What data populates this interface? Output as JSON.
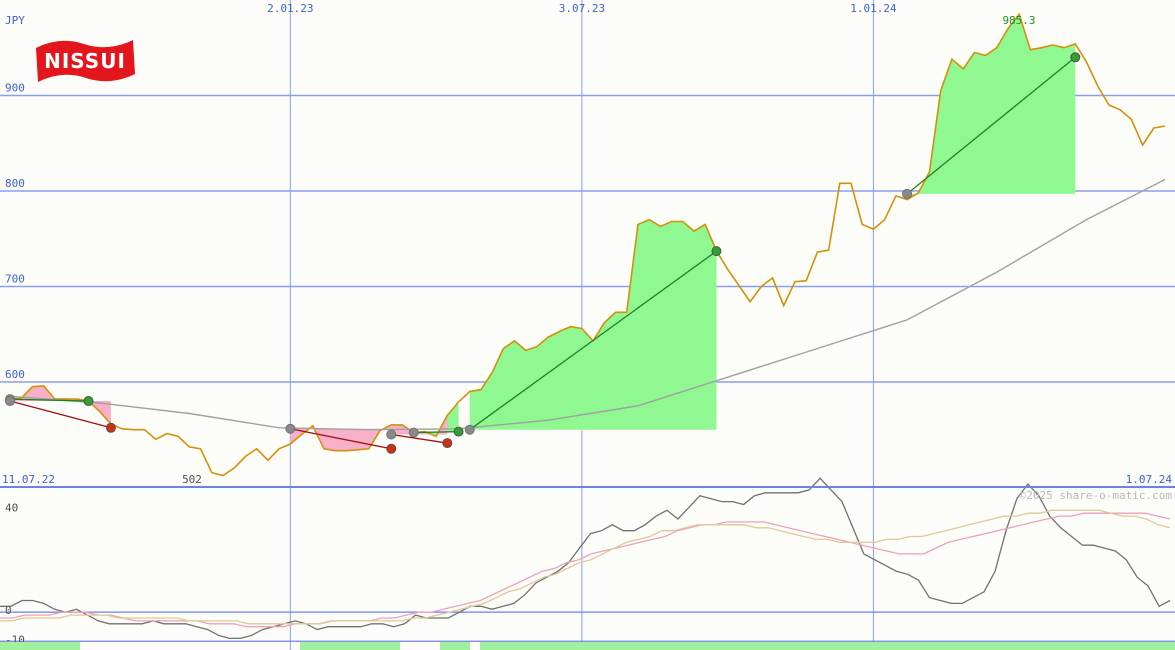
{
  "logo": {
    "text": "NISSUI",
    "color": "#e2161c"
  },
  "copyright": "©2025 share-o-matic.com",
  "chart_data": [
    {
      "type": "line",
      "currency_label": "JPY",
      "y_tick_labels": [
        "600",
        "700",
        "800",
        "900"
      ],
      "y_ticks": [
        600,
        700,
        800,
        900
      ],
      "ylim": [
        490,
        1000
      ],
      "x_tick_labels_top": [
        "2.01.23",
        "3.07.23",
        "1.01.24"
      ],
      "x_ticks": [
        "2023-01-02",
        "2023-07-03",
        "2024-01-01"
      ],
      "x_start_label": "11.07.22",
      "x_end_label": "1.07.24",
      "xlim": [
        "2022-07-11",
        "2024-07-01"
      ],
      "min_label": "502",
      "max_label": "985.3",
      "grid": true,
      "colors": {
        "price": "#d4900a",
        "average": "#a0a0a0",
        "gain": "#90f890",
        "loss": "#f8b0c8",
        "gain_line": "#208020",
        "loss_line": "#a01010",
        "grid": "#8a9ef0"
      },
      "series": [
        {
          "key": "price",
          "x": [
            "2022-07-11",
            "2022-07-18",
            "2022-07-25",
            "2022-08-01",
            "2022-08-08",
            "2022-08-15",
            "2022-08-22",
            "2022-08-29",
            "2022-09-05",
            "2022-09-12",
            "2022-09-19",
            "2022-09-26",
            "2022-10-03",
            "2022-10-10",
            "2022-10-17",
            "2022-10-24",
            "2022-10-31",
            "2022-11-07",
            "2022-11-14",
            "2022-11-21",
            "2022-11-28",
            "2022-12-05",
            "2022-12-12",
            "2022-12-19",
            "2022-12-26",
            "2023-01-02",
            "2023-01-09",
            "2023-01-16",
            "2023-01-23",
            "2023-01-30",
            "2023-02-06",
            "2023-02-13",
            "2023-02-20",
            "2023-02-27",
            "2023-03-06",
            "2023-03-13",
            "2023-03-20",
            "2023-03-27",
            "2023-04-03",
            "2023-04-10",
            "2023-04-17",
            "2023-04-24",
            "2023-05-01",
            "2023-05-08",
            "2023-05-15",
            "2023-05-22",
            "2023-05-29",
            "2023-06-05",
            "2023-06-12",
            "2023-06-19",
            "2023-06-26",
            "2023-07-03",
            "2023-07-10",
            "2023-07-17",
            "2023-07-24",
            "2023-07-31",
            "2023-08-07",
            "2023-08-14",
            "2023-08-21",
            "2023-08-28",
            "2023-09-04",
            "2023-09-11",
            "2023-09-18",
            "2023-09-25",
            "2023-10-02",
            "2023-10-09",
            "2023-10-16",
            "2023-10-23",
            "2023-10-30",
            "2023-11-06",
            "2023-11-13",
            "2023-11-20",
            "2023-11-27",
            "2023-12-04",
            "2023-12-11",
            "2023-12-18",
            "2023-12-25",
            "2024-01-01",
            "2024-01-08",
            "2024-01-15",
            "2024-01-22",
            "2024-01-29",
            "2024-02-05",
            "2024-02-12",
            "2024-02-19",
            "2024-02-26",
            "2024-03-04",
            "2024-03-11",
            "2024-03-18",
            "2024-03-25",
            "2024-04-01",
            "2024-04-08",
            "2024-04-15",
            "2024-04-22",
            "2024-04-29",
            "2024-05-06",
            "2024-05-13",
            "2024-05-20",
            "2024-05-27",
            "2024-06-03",
            "2024-06-10",
            "2024-06-17",
            "2024-06-24",
            "2024-07-01"
          ],
          "values": [
            582,
            583,
            595,
            596,
            582,
            582,
            582,
            580,
            569,
            556,
            551,
            550,
            550,
            540,
            546,
            543,
            532,
            530,
            505,
            502,
            510,
            522,
            530,
            518,
            530,
            535,
            545,
            554,
            530,
            528,
            528,
            529,
            530,
            549,
            555,
            555,
            547,
            548,
            543,
            565,
            579,
            590,
            592,
            610,
            635,
            643,
            633,
            637,
            647,
            653,
            658,
            656,
            643,
            662,
            673,
            673,
            765,
            770,
            763,
            768,
            768,
            758,
            765,
            737,
            718,
            701,
            684,
            700,
            709,
            680,
            705,
            706,
            736,
            738,
            808,
            808,
            765,
            760,
            770,
            795,
            791,
            798,
            820,
            905,
            938,
            928,
            945,
            942,
            950,
            970,
            985,
            948,
            950,
            953,
            950,
            954,
            935,
            910,
            890,
            885,
            875,
            848,
            866,
            868
          ]
        },
        {
          "key": "average",
          "x": [
            "2022-07-11",
            "2022-09-05",
            "2022-10-31",
            "2022-12-26",
            "2023-02-20",
            "2023-04-17",
            "2023-06-12",
            "2023-08-07",
            "2023-10-02",
            "2023-11-27",
            "2024-01-22",
            "2024-03-18",
            "2024-05-13",
            "2024-07-01"
          ],
          "values": [
            585,
            578,
            567,
            552,
            550,
            551,
            560,
            575,
            605,
            635,
            665,
            715,
            770,
            812
          ]
        }
      ],
      "gain_trades": [
        {
          "start": [
            "2022-07-11",
            582
          ],
          "end": [
            "2022-08-29",
            580
          ]
        },
        {
          "start": [
            "2023-03-20",
            547
          ],
          "end": [
            "2023-04-17",
            548
          ]
        },
        {
          "start": [
            "2023-04-24",
            550
          ],
          "end": [
            "2023-09-25",
            737
          ]
        },
        {
          "start": [
            "2024-01-22",
            797
          ],
          "end": [
            "2024-05-06",
            940
          ]
        }
      ],
      "loss_trades": [
        {
          "start": [
            "2022-07-11",
            580
          ],
          "end": [
            "2022-09-12",
            552
          ]
        },
        {
          "start": [
            "2023-01-02",
            551
          ],
          "end": [
            "2023-03-06",
            530
          ]
        },
        {
          "start": [
            "2023-03-06",
            545
          ],
          "end": [
            "2023-04-10",
            536
          ]
        }
      ]
    },
    {
      "type": "line",
      "y_tick_labels": [
        "40",
        "0",
        "-10"
      ],
      "y_ticks": [
        40,
        0,
        -10
      ],
      "ylim": [
        -13,
        43
      ],
      "colors": {
        "momentum": "#707070",
        "signal_fast": "#f0a0b8",
        "signal_slow": "#e0c898",
        "volume": "#a0f0a0"
      },
      "series": [
        {
          "key": "momentum",
          "values": [
            2,
            2,
            4,
            4,
            3,
            1,
            0,
            1,
            -1,
            -3,
            -4,
            -4,
            -4,
            -4,
            -3,
            -4,
            -4,
            -4,
            -5,
            -6,
            -8,
            -9,
            -9,
            -8,
            -6,
            -5,
            -4,
            -3,
            -4,
            -6,
            -5,
            -5,
            -5,
            -5,
            -4,
            -4,
            -5,
            -4,
            -1,
            -2,
            -2,
            -2,
            0,
            2,
            2,
            1,
            2,
            3,
            6,
            10,
            12,
            14,
            17,
            22,
            27,
            28,
            30,
            28,
            28,
            30,
            33,
            35,
            32,
            36,
            40,
            39,
            38,
            38,
            37,
            40,
            41,
            41,
            41,
            41,
            42,
            46,
            42,
            38,
            29,
            20,
            18,
            16,
            14,
            13,
            11,
            5,
            4,
            3,
            3,
            5,
            7,
            14,
            28,
            39,
            44,
            40,
            33,
            29,
            26,
            23,
            23,
            22,
            21,
            18,
            12,
            9,
            2,
            4
          ]
        },
        {
          "key": "signal_fast",
          "values": [
            -2,
            -2,
            -1,
            -1,
            -1,
            0,
            0,
            0,
            -1,
            -1,
            -2,
            -3,
            -3,
            -3,
            -3,
            -3,
            -3,
            -4,
            -4,
            -4,
            -5,
            -5,
            -5,
            -5,
            -4,
            -4,
            -4,
            -3,
            -3,
            -3,
            -3,
            -2,
            -2,
            -1,
            0,
            0,
            1,
            2,
            3,
            4,
            6,
            8,
            10,
            12,
            14,
            15,
            17,
            18,
            20,
            21,
            22,
            23,
            24,
            25,
            26,
            28,
            29,
            30,
            30,
            31,
            31,
            31,
            31,
            30,
            29,
            28,
            27,
            26,
            25,
            24,
            23,
            22,
            21,
            20,
            20,
            20,
            22,
            24,
            25,
            26,
            27,
            28,
            29,
            30,
            31,
            32,
            33,
            33,
            34,
            34,
            34,
            34,
            34,
            34,
            33,
            32
          ]
        },
        {
          "key": "signal_slow",
          "values": [
            -3,
            -3,
            -2,
            -2,
            -2,
            -2,
            -1,
            -1,
            -1,
            -1,
            -2,
            -2,
            -2,
            -2,
            -2,
            -2,
            -3,
            -3,
            -3,
            -3,
            -3,
            -4,
            -4,
            -4,
            -4,
            -4,
            -4,
            -4,
            -3,
            -3,
            -3,
            -3,
            -3,
            -3,
            -3,
            -2,
            -2,
            -1,
            0,
            1,
            2,
            3,
            5,
            7,
            8,
            10,
            12,
            13,
            15,
            17,
            18,
            20,
            22,
            24,
            25,
            26,
            28,
            28,
            29,
            30,
            30,
            30,
            30,
            30,
            29,
            29,
            28,
            27,
            26,
            25,
            25,
            24,
            24,
            24,
            24,
            25,
            25,
            26,
            26,
            27,
            28,
            29,
            30,
            31,
            32,
            33,
            33,
            34,
            34,
            35,
            35,
            35,
            35,
            35,
            34,
            33,
            33,
            32,
            30,
            29
          ]
        }
      ]
    }
  ]
}
